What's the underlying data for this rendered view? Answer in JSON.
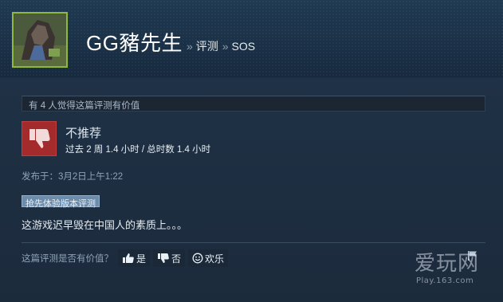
{
  "header": {
    "persona_name": "GG豬先生",
    "breadcrumb_sep_1": "»",
    "breadcrumb_reviews": "评测",
    "breadcrumb_sep_2": "»",
    "breadcrumb_game": "SOS"
  },
  "review": {
    "helpful_count_text": "有 4 人觉得这篇评测有价值",
    "verdict": "不推荐",
    "verdict_icon": "thumbs-down-icon",
    "hours_text": "过去 2 周 1.4 小时 / 总时数 1.4 小时",
    "posted_text": "发布于：3月2日上午1:22",
    "early_access_tag": "抢先体验版本评测",
    "body": "这游戏迟早毁在中国人的素质上。。。"
  },
  "voting": {
    "question": "这篇评测是否有价值？",
    "yes_label": "是",
    "no_label": "否",
    "funny_label": "欢乐"
  },
  "watermark": {
    "main": "爱玩网",
    "sub": "Play.163.com"
  },
  "colors": {
    "background": "#1b2838",
    "header": "#1f3a52",
    "thumb_down_red": "#a32b2b",
    "avatar_border": "#8fb83f",
    "ea_tag": "#6c8cab"
  }
}
